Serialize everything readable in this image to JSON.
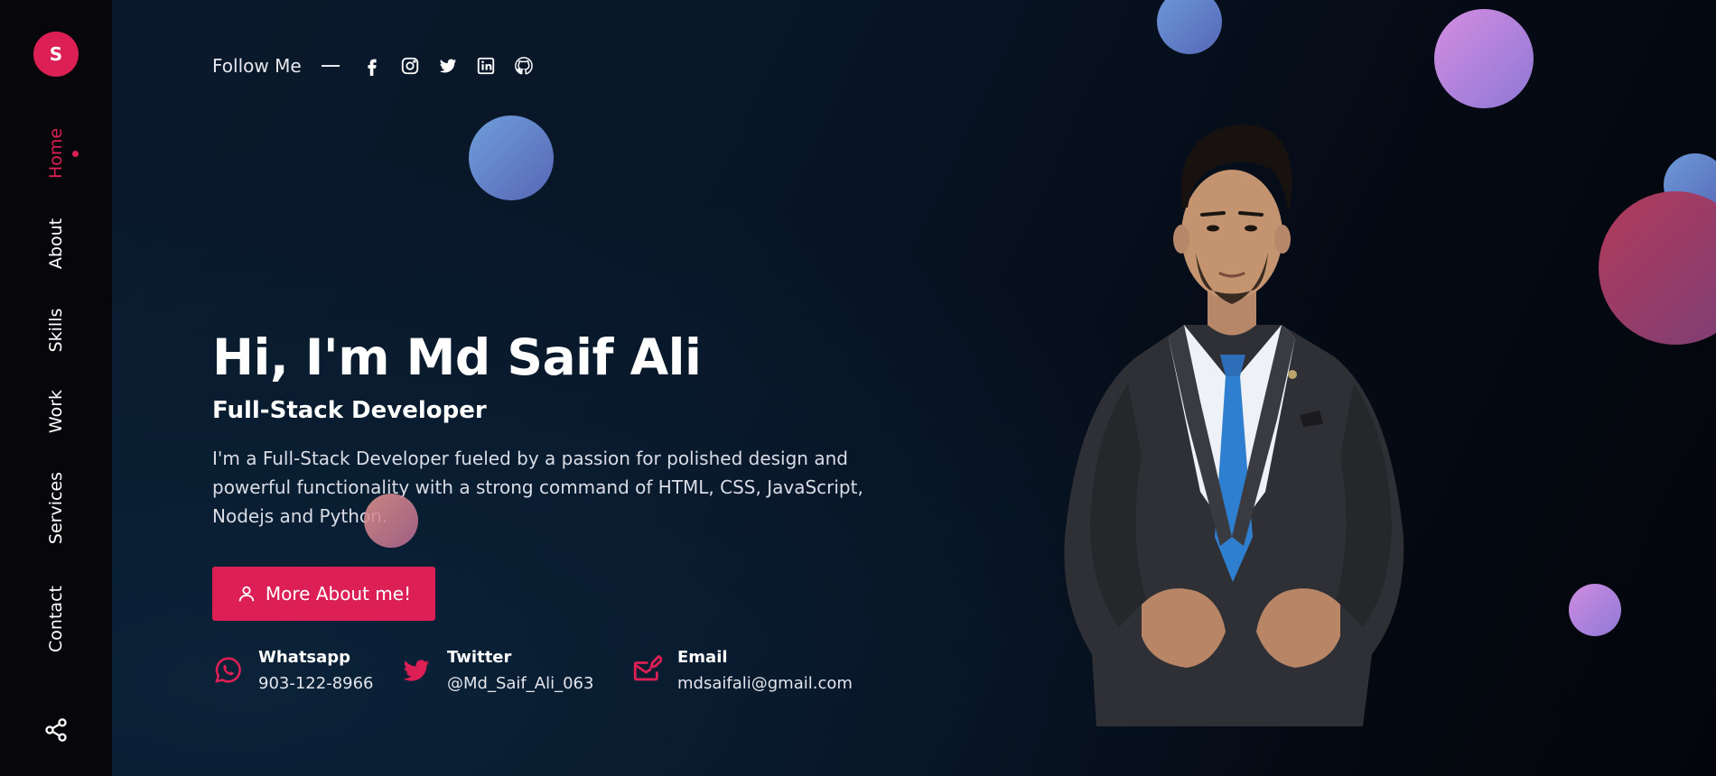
{
  "brand": {
    "initial": "S"
  },
  "nav": {
    "items": [
      {
        "label": "Home",
        "active": true
      },
      {
        "label": "About"
      },
      {
        "label": "Skills"
      },
      {
        "label": "Work"
      },
      {
        "label": "Services"
      },
      {
        "label": "Contact"
      }
    ],
    "share_icon": "share-icon"
  },
  "follow": {
    "label": "Follow Me",
    "icons": [
      "facebook-icon",
      "instagram-icon",
      "twitter-icon",
      "linkedin-icon",
      "github-icon"
    ]
  },
  "hero": {
    "title": "Hi, I'm Md Saif Ali",
    "subtitle": "Full-Stack Developer",
    "description": "I'm a Full-Stack Developer fueled by a passion for polished design and powerful functionality with a strong command of HTML, CSS, JavaScript, Nodejs and Python.",
    "cta_label": "More About me!"
  },
  "contacts": [
    {
      "title": "Whatsapp",
      "value": "903-122-8966",
      "icon": "whatsapp-icon"
    },
    {
      "title": "Twitter",
      "value": "@Md_Saif_Ali_063",
      "icon": "twitter-icon"
    },
    {
      "title": "Email",
      "value": "mdsaifali@gmail.com",
      "icon": "email-icon"
    }
  ],
  "colors": {
    "accent": "#dc1f55",
    "sidebar": "#07070b",
    "background": "#081526"
  }
}
